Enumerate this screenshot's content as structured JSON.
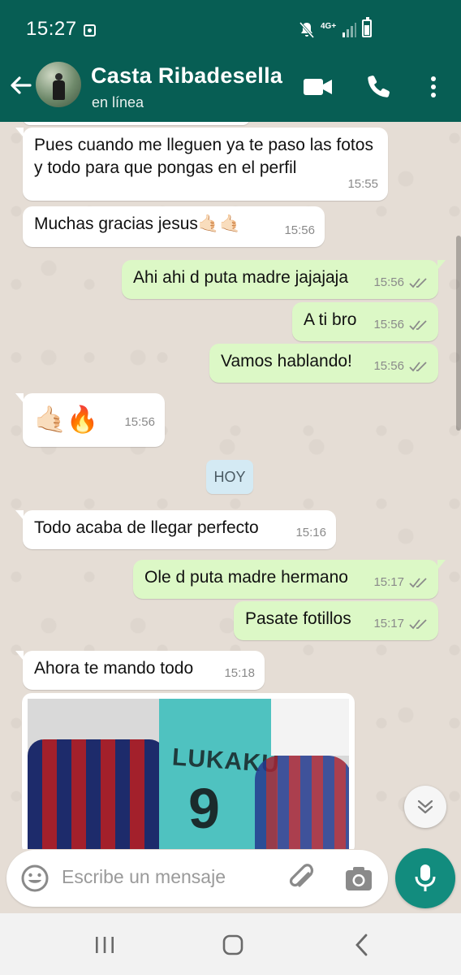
{
  "status_bar": {
    "time": "15:27",
    "network": "4G+"
  },
  "header": {
    "contact_name": "Casta Ribadesella",
    "contact_status": "en línea"
  },
  "messages": [
    {
      "dir": "in",
      "text": "Pues cuando me lleguen ya te paso las fotos y todo para que pongas en el perfil",
      "time": "15:55"
    },
    {
      "dir": "in",
      "text": "Muchas gracias jesus🤙🏻🤙🏻",
      "time": "15:56"
    },
    {
      "dir": "out",
      "text": "Ahi ahi d puta madre jajajaja",
      "time": "15:56",
      "read": true
    },
    {
      "dir": "out",
      "text": "A ti bro",
      "time": "15:56",
      "read": true
    },
    {
      "dir": "out",
      "text": "Vamos hablando!",
      "time": "15:56",
      "read": true
    },
    {
      "dir": "in",
      "text": "🤙🏻🔥",
      "time": "15:56"
    },
    {
      "dir": "in",
      "text": "Todo acaba de llegar perfecto",
      "time": "15:16"
    },
    {
      "dir": "out",
      "text": "Ole d puta madre hermano",
      "time": "15:17",
      "read": true
    },
    {
      "dir": "out",
      "text": "Pasate fotillos",
      "time": "15:17",
      "read": true
    },
    {
      "dir": "in",
      "text": "Ahora te mando todo",
      "time": "15:18"
    }
  ],
  "day_divider": "HOY",
  "photo": {
    "jersey_text": "LUKAKU",
    "jersey_number": "9"
  },
  "composer": {
    "placeholder": "Escribe un mensaje"
  },
  "colors": {
    "header": "#075e54",
    "outgoing_bubble": "#dcf8c6",
    "incoming_bubble": "#ffffff",
    "chat_background": "#e5ddd5",
    "mic_button": "#128c7e",
    "read_ticks": "#8a8a8a"
  },
  "icons": [
    "back-arrow-icon",
    "video-call-icon",
    "phone-icon",
    "more-vert-icon",
    "double-check-icon",
    "chevron-double-down-icon",
    "emoji-icon",
    "attach-icon",
    "camera-icon",
    "mic-icon"
  ]
}
